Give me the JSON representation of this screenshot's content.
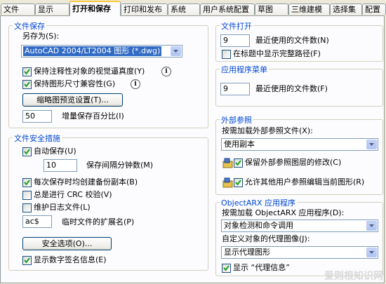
{
  "tabs": [
    "文件",
    "显示",
    "打开和保存",
    "打印和发布",
    "系统",
    "用户系统配置",
    "草图",
    "三维建模",
    "选择集",
    "配置"
  ],
  "file_save": {
    "title": "文件保存",
    "save_as_label": "另存为(S):",
    "save_as_value": "AutoCAD 2004/LT2004 图形 (*.dwg)",
    "annot_label": "保持注释性对象的视觉逼真度(Y)",
    "annot_checked": true,
    "sizes_label": "保持图形尺寸兼容性(G)",
    "sizes_checked": true,
    "thumb_button": "缩略图预览设置(T)...",
    "incremental_value": "50",
    "incremental_label": "增量保存百分比(I)"
  },
  "file_safety": {
    "title": "文件安全措施",
    "autosave_label": "自动保存(U)",
    "autosave_checked": true,
    "minutes_value": "10",
    "minutes_label": "保存间隔分钟数(M)",
    "backup_label": "每次保存时均创建备份副本(B)",
    "backup_checked": true,
    "crc_label": "总是进行 CRC 校验(V)",
    "crc_checked": false,
    "log_label": "维护日志文件(L)",
    "log_checked": false,
    "ext_value": "ac$",
    "ext_label": "临时文件的扩展名(P)",
    "security_button": "安全选项(O)...",
    "digsig_label": "显示数字签名信息(E)",
    "digsig_checked": true
  },
  "file_open": {
    "title": "文件打开",
    "recent_value": "9",
    "recent_label": "最近使用的文件数(N)",
    "fullpath_label": "在标题中显示完整路径(F)",
    "fullpath_checked": false
  },
  "app_menu": {
    "title": "应用程序菜单",
    "recent_value": "9",
    "recent_label": "最近使用的文件数(F)"
  },
  "xrefs": {
    "title": "外部参照",
    "demand_label": "按需加载外部参照文件(X):",
    "demand_value": "使用副本",
    "retain_label": "保留外部参照图层的修改(C)",
    "retain_checked": true,
    "allow_label": "允许其他用户参照编辑当前图形(R)",
    "allow_checked": true
  },
  "objectarx": {
    "title": "ObjectARX 应用程序",
    "demand_label": "按需加载 ObjectARX 应用程序(D):",
    "demand_value": "对象检测和命令调用",
    "proxy_label": "自定义对象的代理图像(J):",
    "proxy_value": "显示代理图形",
    "proxy_info_label": "显示 “代理信息”",
    "proxy_info_checked": true
  },
  "watermark": "爱则根知识网"
}
